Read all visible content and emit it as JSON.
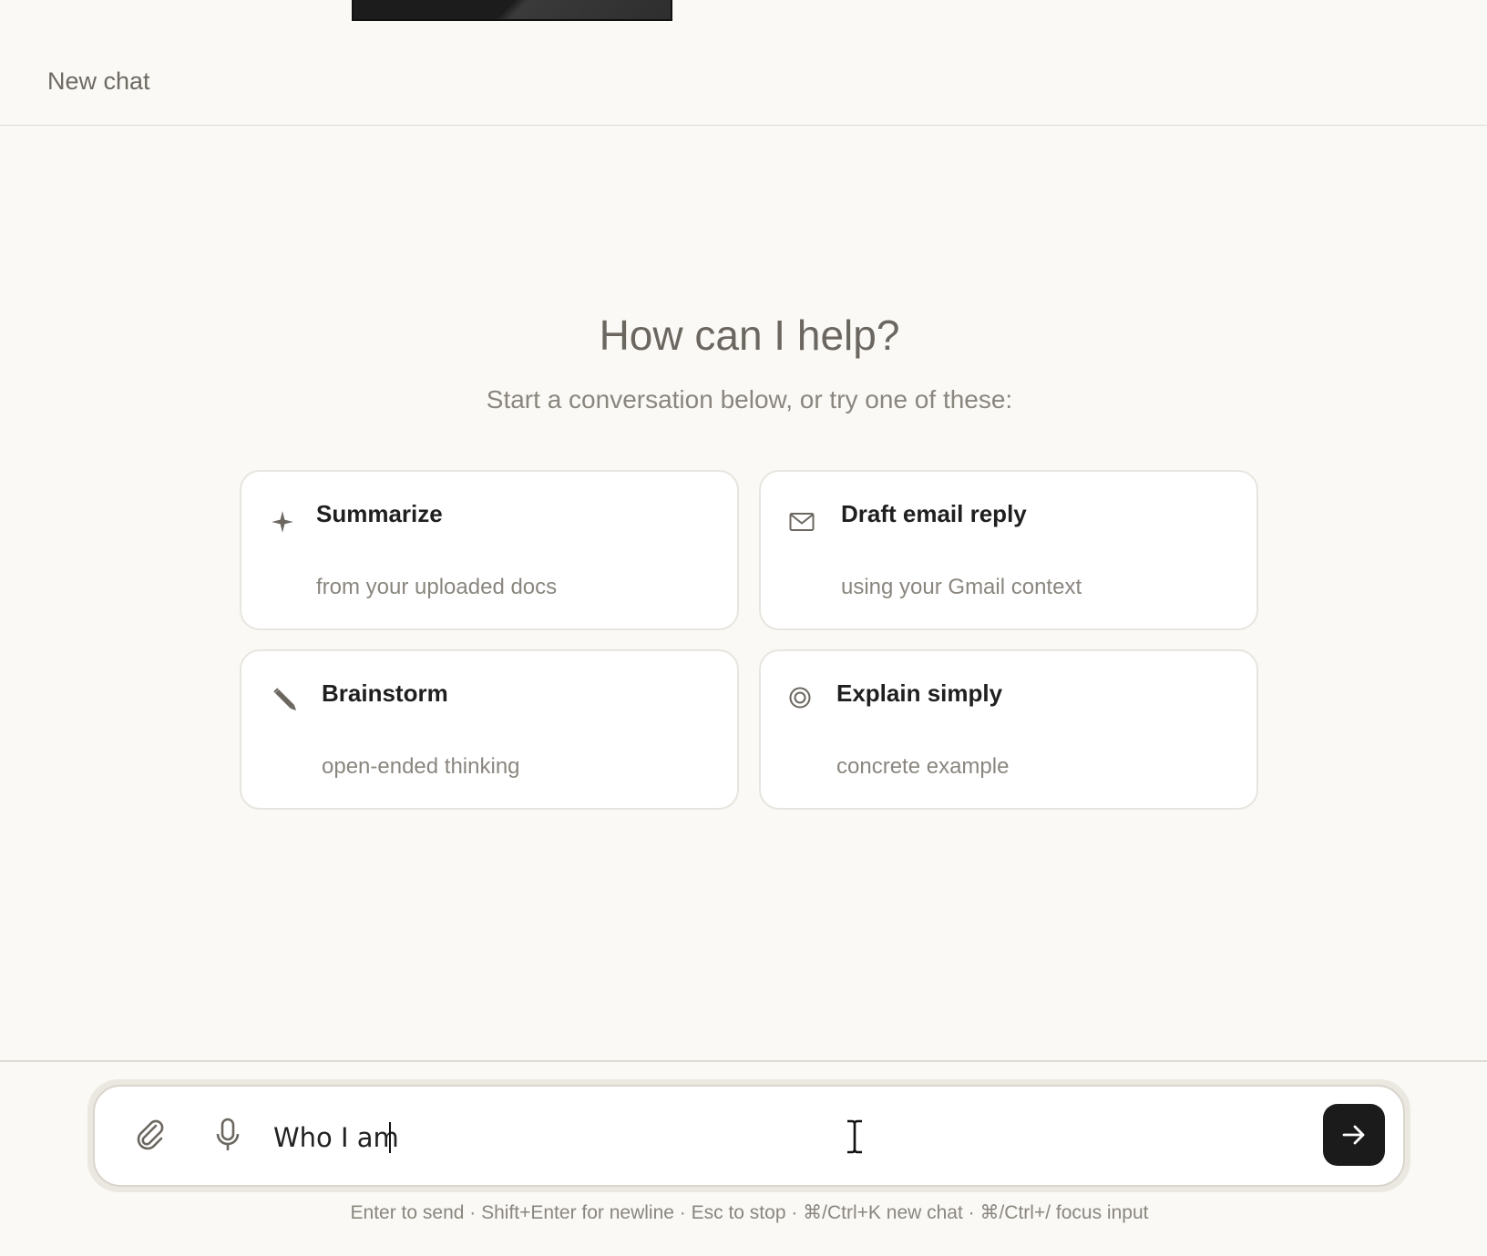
{
  "header": {
    "title": "New chat"
  },
  "hero": {
    "title": "How can I help?",
    "subtitle": "Start a conversation below, or try one of these:"
  },
  "suggestions": [
    {
      "title": "Summarize",
      "subtitle": "from your uploaded docs",
      "icon": "sparkle-icon"
    },
    {
      "title": "Draft email reply",
      "subtitle": "using your Gmail context",
      "icon": "envelope-icon"
    },
    {
      "title": "Brainstorm",
      "subtitle": "open-ended thinking",
      "icon": "pencil-icon"
    },
    {
      "title": "Explain simply",
      "subtitle": "concrete example",
      "icon": "target-icon"
    }
  ],
  "composer": {
    "value": "Who I am",
    "attach_icon": "paperclip-icon",
    "mic_icon": "microphone-icon",
    "send_icon": "arrow-right-icon"
  },
  "hint": "Enter to send · Shift+Enter for newline · Esc to stop · ⌘/Ctrl+K new chat · ⌘/Ctrl+/ focus input",
  "colors": {
    "background": "#faf9f5",
    "card_border": "#e8e5df",
    "send_button": "#1b1b1b",
    "muted_text": "#8a867f"
  }
}
